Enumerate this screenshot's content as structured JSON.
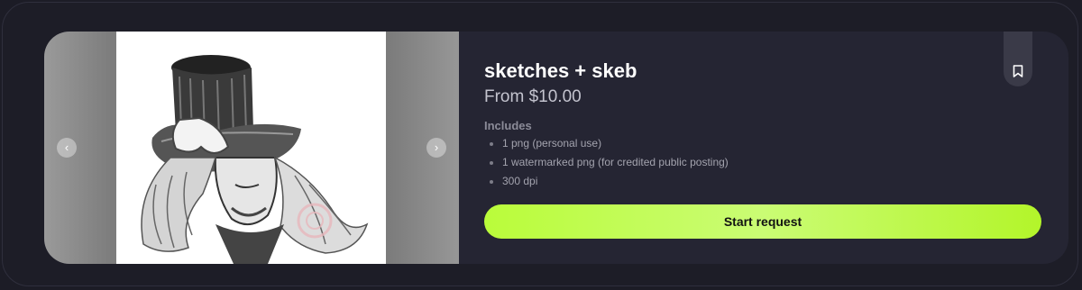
{
  "listing": {
    "title": "sketches + skeb",
    "price": "From $10.00",
    "includes_label": "Includes",
    "includes": [
      "1 png (personal use)",
      "1 watermarked png (for credited public posting)",
      "300 dpi"
    ],
    "cta_label": "Start request"
  },
  "gallery": {
    "prev_icon": "chevron-left-icon",
    "next_icon": "chevron-right-icon",
    "prev_glyph": "‹",
    "next_glyph": "›"
  },
  "colors": {
    "background": "#1c1c26",
    "card": "#252533",
    "accent": "#c4fc4c",
    "title": "#ffffff",
    "muted": "#8b8b98"
  }
}
